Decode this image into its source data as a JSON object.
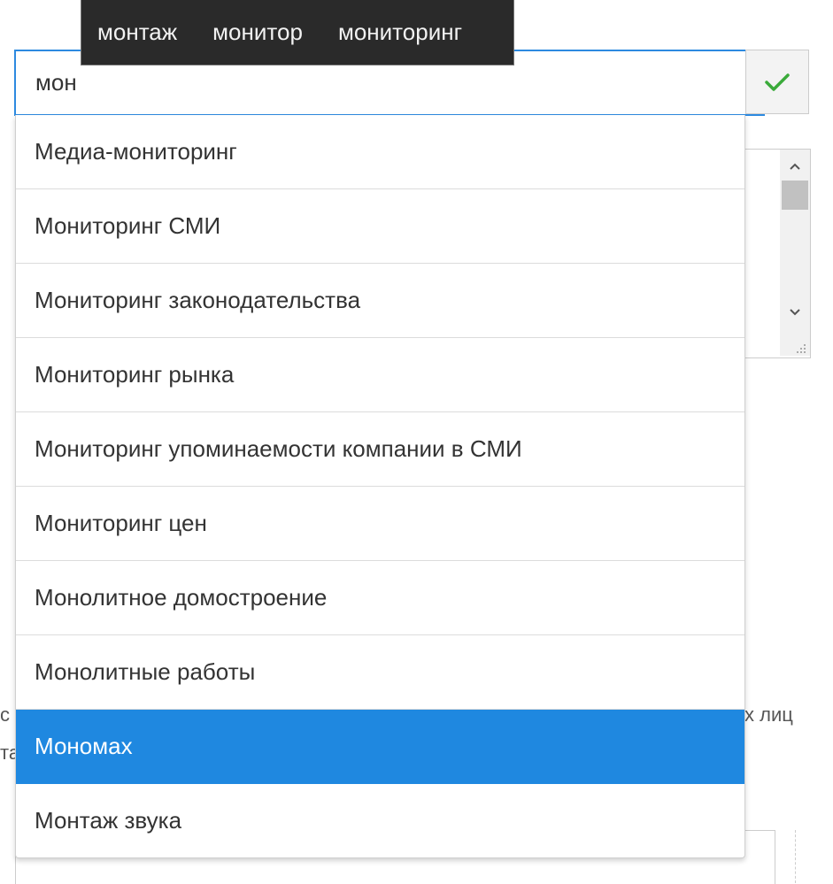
{
  "suggestions": [
    "монтаж",
    "монитор",
    "мониторинг"
  ],
  "search": {
    "value": "мон"
  },
  "options": [
    {
      "label": "Медиа-мониторинг",
      "selected": false
    },
    {
      "label": "Мониторинг СМИ",
      "selected": false
    },
    {
      "label": "Мониторинг законодательства",
      "selected": false
    },
    {
      "label": "Мониторинг рынка",
      "selected": false
    },
    {
      "label": "Мониторинг упоминаемости компании в СМИ",
      "selected": false
    },
    {
      "label": "Мониторинг цен",
      "selected": false
    },
    {
      "label": "Монолитное домостроение",
      "selected": false
    },
    {
      "label": "Монолитные работы",
      "selected": false
    },
    {
      "label": "Мономах",
      "selected": true
    },
    {
      "label": "Монтаж звука",
      "selected": false
    }
  ],
  "background": {
    "fragment_left_1": "с",
    "fragment_left_2": "та",
    "fragment_right_1": "х лиц"
  },
  "colors": {
    "accent": "#1f88e0",
    "input_border": "#2d8ae0",
    "check": "#3aaa3a",
    "suggest_bg": "#2a2a2a"
  },
  "icons": {
    "confirm": "check-icon",
    "scroll_up": "chevron-up-icon",
    "scroll_down": "chevron-down-icon"
  }
}
